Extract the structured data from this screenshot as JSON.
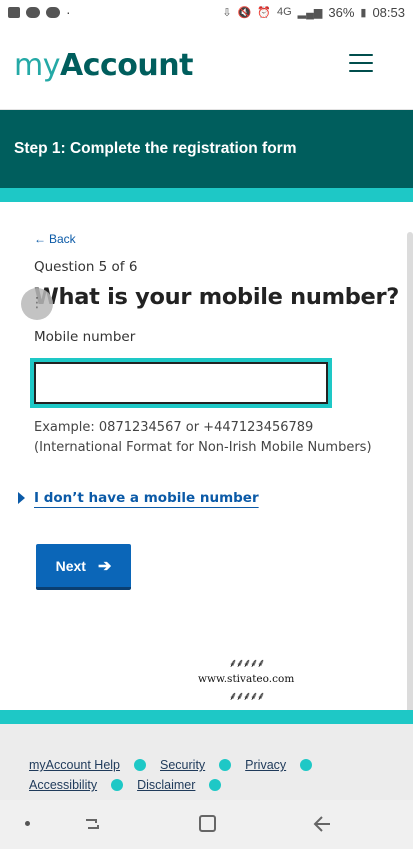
{
  "status_bar": {
    "network": "4G",
    "battery": "36%",
    "time": "08:53"
  },
  "header": {
    "logo_my": "my",
    "logo_account": "Account",
    "menu_icon": "hamburger-menu-icon"
  },
  "step_banner": {
    "title": "Step 1: Complete the registration form"
  },
  "form": {
    "back_label": "Back",
    "question_count": "Question 5 of 6",
    "question": "What is your mobile number?",
    "field_label": "Mobile number",
    "input_value": "",
    "hint": "Example: 0871234567 or +447123456789 (International Format for Non-Irish Mobile Numbers)",
    "no_mobile_link": "I don’t have a mobile number",
    "next_label": "Next"
  },
  "watermark": {
    "text": "www.stivateo.com"
  },
  "footer": {
    "links_row1": [
      "myAccount Help",
      "Security",
      "Privacy"
    ],
    "links_row2": [
      "Accessibility",
      "Disclaimer"
    ]
  },
  "colors": {
    "brand_dark": "#005e5d",
    "brand_teal": "#1ec8c6",
    "link_blue": "#0b5aa7",
    "button_blue": "#0b66b8"
  }
}
